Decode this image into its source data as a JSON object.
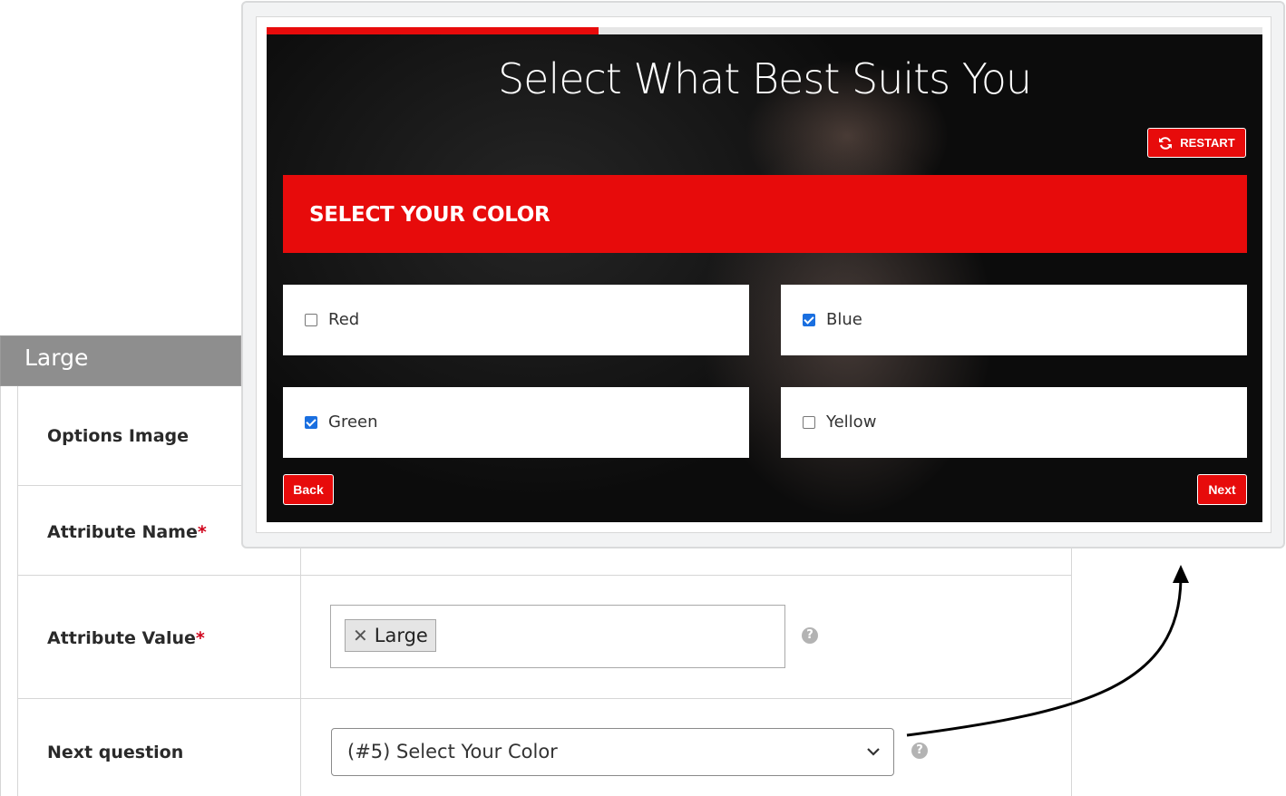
{
  "admin": {
    "header_title": "Large",
    "rows": {
      "options_image": "Options Image",
      "attribute_name": "Attribute Name",
      "attribute_value": "Attribute Value",
      "next_question": "Next question",
      "required_marker": "*"
    },
    "attribute_value_tags": [
      "Large"
    ],
    "tag_remove_glyph": "✕",
    "next_question_selected": "(#5) Select Your Color",
    "help_glyph": "?"
  },
  "quiz": {
    "title": "Select What Best Suits You",
    "progress_fraction": 0.333,
    "restart_label": "RESTART",
    "question": "SELECT YOUR COLOR",
    "options": [
      {
        "label": "Red",
        "checked": false
      },
      {
        "label": "Blue",
        "checked": true
      },
      {
        "label": "Green",
        "checked": true
      },
      {
        "label": "Yellow",
        "checked": false
      }
    ],
    "back_label": "Back",
    "next_label": "Next"
  },
  "colors": {
    "accent": "#e70b0b",
    "admin_header": "#8e8e8e",
    "checkbox_checked": "#1a6fe0"
  }
}
